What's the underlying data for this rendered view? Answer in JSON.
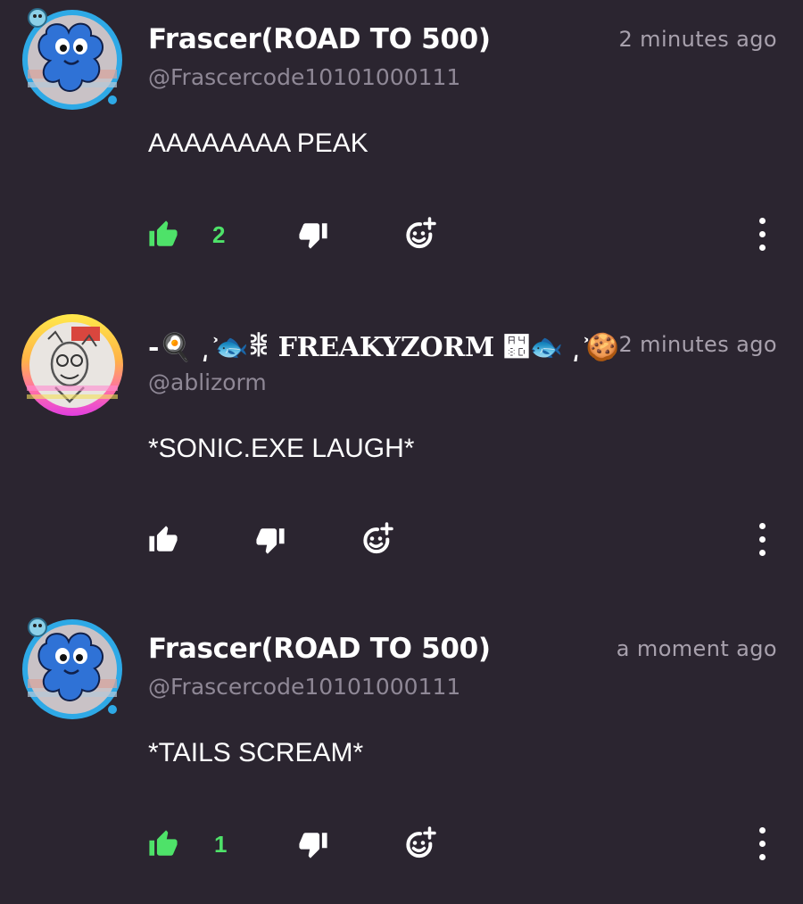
{
  "colors": {
    "background": "#2b2530",
    "liked": "#4ee269",
    "muted": "#8f8896"
  },
  "comments": [
    {
      "author": "Frascer(ROAD TO 500)",
      "handle": "@Frascercode10101000111",
      "time": "2 minutes ago",
      "text": "AAAAAAAA PEAK",
      "likes": "2",
      "liked": true,
      "avatar_icon": "blue-creature-avatar-icon"
    },
    {
      "author": "-🍳 ͵ ͐🐟ꒌ FREAKYZORM ꒍🐟 ͵ ͐🍪",
      "handle": "@ablizorm",
      "time": "2 minutes ago",
      "text": "*SONIC.EXE LAUGH*",
      "likes": "",
      "liked": false,
      "avatar_icon": "sketch-drawing-avatar-icon"
    },
    {
      "author": "Frascer(ROAD TO 500)",
      "handle": "@Frascercode10101000111",
      "time": "a moment ago",
      "text": "*TAILS SCREAM*",
      "likes": "1",
      "liked": true,
      "avatar_icon": "blue-creature-avatar-icon"
    }
  ]
}
